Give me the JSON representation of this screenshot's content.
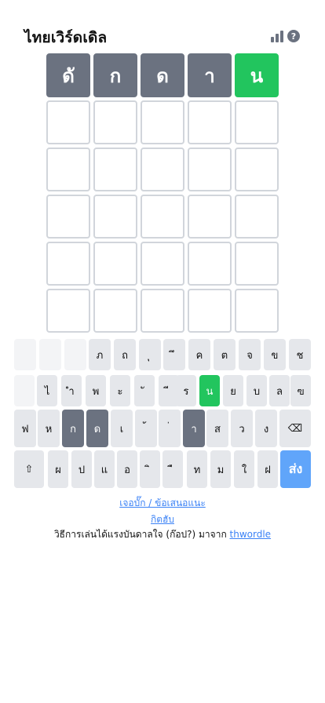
{
  "header": {
    "title": "ไทยเวิร์ดเดิล",
    "help_symbol": "?"
  },
  "board": {
    "rows": [
      [
        {
          "letter": "ดั",
          "state": "absent"
        },
        {
          "letter": "ก",
          "state": "absent"
        },
        {
          "letter": "ด",
          "state": "absent"
        },
        {
          "letter": "า",
          "state": "absent"
        },
        {
          "letter": "น",
          "state": "correct"
        }
      ],
      [
        {
          "letter": "",
          "state": "empty"
        },
        {
          "letter": "",
          "state": "empty"
        },
        {
          "letter": "",
          "state": "empty"
        },
        {
          "letter": "",
          "state": "empty"
        },
        {
          "letter": "",
          "state": "empty"
        }
      ],
      [
        {
          "letter": "",
          "state": "empty"
        },
        {
          "letter": "",
          "state": "empty"
        },
        {
          "letter": "",
          "state": "empty"
        },
        {
          "letter": "",
          "state": "empty"
        },
        {
          "letter": "",
          "state": "empty"
        }
      ],
      [
        {
          "letter": "",
          "state": "empty"
        },
        {
          "letter": "",
          "state": "empty"
        },
        {
          "letter": "",
          "state": "empty"
        },
        {
          "letter": "",
          "state": "empty"
        },
        {
          "letter": "",
          "state": "empty"
        }
      ],
      [
        {
          "letter": "",
          "state": "empty"
        },
        {
          "letter": "",
          "state": "empty"
        },
        {
          "letter": "",
          "state": "empty"
        },
        {
          "letter": "",
          "state": "empty"
        },
        {
          "letter": "",
          "state": "empty"
        }
      ],
      [
        {
          "letter": "",
          "state": "empty"
        },
        {
          "letter": "",
          "state": "empty"
        },
        {
          "letter": "",
          "state": "empty"
        },
        {
          "letter": "",
          "state": "empty"
        },
        {
          "letter": "",
          "state": "empty"
        }
      ]
    ]
  },
  "keyboard": {
    "rows": [
      [
        {
          "label": "",
          "state": "blank"
        },
        {
          "label": "",
          "state": "blank"
        },
        {
          "label": "",
          "state": "blank"
        },
        {
          "label": "ภ",
          "state": "unused"
        },
        {
          "label": "ถ",
          "state": "unused"
        },
        {
          "label": "ุ",
          "state": "unused"
        },
        {
          "label": "ึ",
          "state": "unused"
        },
        {
          "label": "ค",
          "state": "unused"
        },
        {
          "label": "ต",
          "state": "unused"
        },
        {
          "label": "จ",
          "state": "unused"
        },
        {
          "label": "ข",
          "state": "unused"
        },
        {
          "label": "ช",
          "state": "unused"
        }
      ],
      [
        {
          "label": "",
          "state": "blank"
        },
        {
          "label": "ไ",
          "state": "unused"
        },
        {
          "label": "ำ",
          "state": "unused"
        },
        {
          "label": "พ",
          "state": "unused"
        },
        {
          "label": "ะ",
          "state": "unused"
        },
        {
          "label": "ั",
          "state": "unused"
        },
        {
          "label": "ี",
          "state": "unused"
        },
        {
          "label": "ร",
          "state": "unused"
        },
        {
          "label": "น",
          "state": "correct"
        },
        {
          "label": "ย",
          "state": "unused"
        },
        {
          "label": "บ",
          "state": "unused"
        },
        {
          "label": "ล",
          "state": "unused"
        },
        {
          "label": "ฃ",
          "state": "unused"
        }
      ],
      [
        {
          "label": "ฟ",
          "state": "unused"
        },
        {
          "label": "ห",
          "state": "unused"
        },
        {
          "label": "ก",
          "state": "absent"
        },
        {
          "label": "ด",
          "state": "absent"
        },
        {
          "label": "เ",
          "state": "unused"
        },
        {
          "label": "้",
          "state": "unused"
        },
        {
          "label": "่",
          "state": "unused"
        },
        {
          "label": "า",
          "state": "absent"
        },
        {
          "label": "ส",
          "state": "unused"
        },
        {
          "label": "ว",
          "state": "unused"
        },
        {
          "label": "ง",
          "state": "unused"
        },
        {
          "label": "⌫",
          "state": "backspace"
        }
      ],
      [
        {
          "label": "⇧",
          "state": "shift"
        },
        {
          "label": "ผ",
          "state": "unused"
        },
        {
          "label": "ป",
          "state": "unused"
        },
        {
          "label": "แ",
          "state": "unused"
        },
        {
          "label": "อ",
          "state": "unused"
        },
        {
          "label": "ิ",
          "state": "unused"
        },
        {
          "label": "ื",
          "state": "unused"
        },
        {
          "label": "ท",
          "state": "unused"
        },
        {
          "label": "ม",
          "state": "unused"
        },
        {
          "label": "ใ",
          "state": "unused"
        },
        {
          "label": "ฝ",
          "state": "unused"
        },
        {
          "label": "ส่ง",
          "state": "submit"
        }
      ]
    ]
  },
  "footer": {
    "bug_report_link": "เจอบั๊ก / ข้อเสนอแนะ",
    "github_link": "กิตฮับ",
    "credit_text": "วิธีการเล่นได้แรงบันดาลใจ (ก๊อป?) มาจาก ",
    "credit_link": "thwordle"
  },
  "colors": {
    "absent": "#6b7280",
    "correct": "#22c55e",
    "submit": "#60a5fa",
    "key_default": "#e5e7eb",
    "link": "#3b82f6"
  }
}
